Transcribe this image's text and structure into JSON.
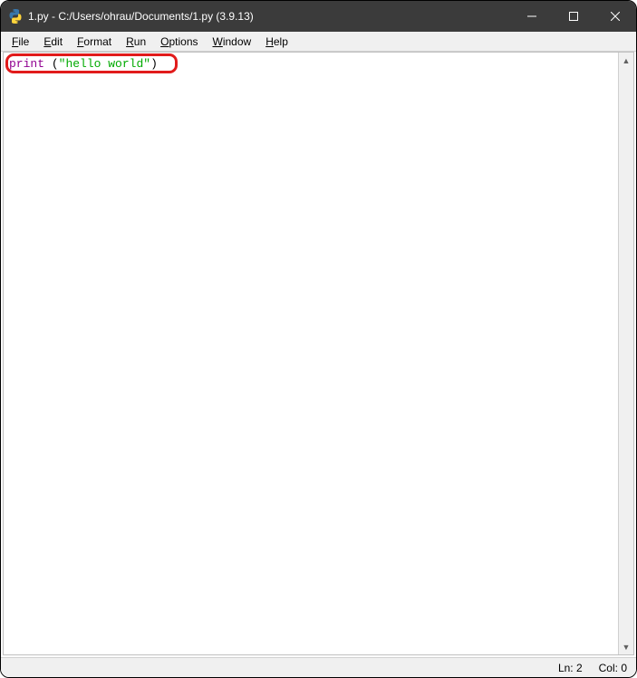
{
  "window": {
    "title": "1.py - C:/Users/ohrau/Documents/1.py (3.9.13)"
  },
  "menu": {
    "file": {
      "accel": "F",
      "rest": "ile"
    },
    "edit": {
      "accel": "E",
      "rest": "dit"
    },
    "format": {
      "accel": "F",
      "rest": "ormat",
      "full": "Format"
    },
    "run": {
      "accel": "R",
      "rest": "un"
    },
    "options": {
      "accel": "O",
      "rest": "ptions"
    },
    "window": {
      "accel": "W",
      "rest": "indow"
    },
    "help": {
      "accel": "H",
      "rest": "elp"
    }
  },
  "editor": {
    "code": {
      "builtin": "print",
      "space": " ",
      "lparen": "(",
      "string": "\"hello world\"",
      "rparen": ")"
    }
  },
  "status": {
    "line": "Ln: 2",
    "col": "Col: 0"
  },
  "scroll": {
    "up": "▲",
    "down": "▼"
  }
}
